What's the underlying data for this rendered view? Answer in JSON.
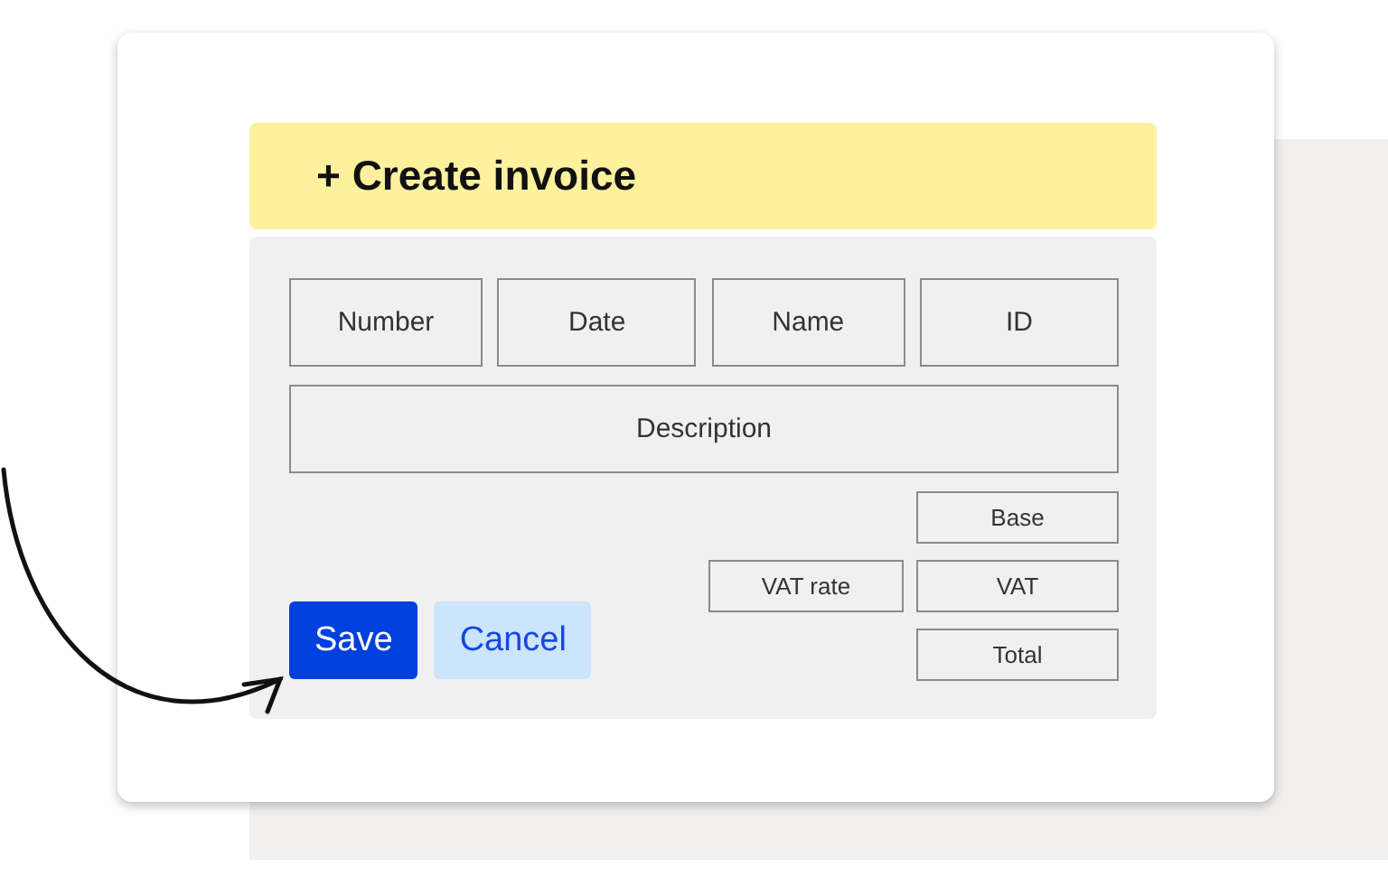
{
  "header": {
    "title": "+ Create invoice"
  },
  "fields": [
    {
      "label": "Number"
    },
    {
      "label": "Date"
    },
    {
      "label": "Name"
    },
    {
      "label": "ID"
    }
  ],
  "description": {
    "label": "Description"
  },
  "amounts": {
    "base": "Base",
    "vat_rate": "VAT rate",
    "vat": "VAT",
    "total": "Total"
  },
  "buttons": [
    {
      "label": "Save",
      "kind": "primary"
    },
    {
      "label": "Cancel",
      "kind": "secondary"
    }
  ]
}
